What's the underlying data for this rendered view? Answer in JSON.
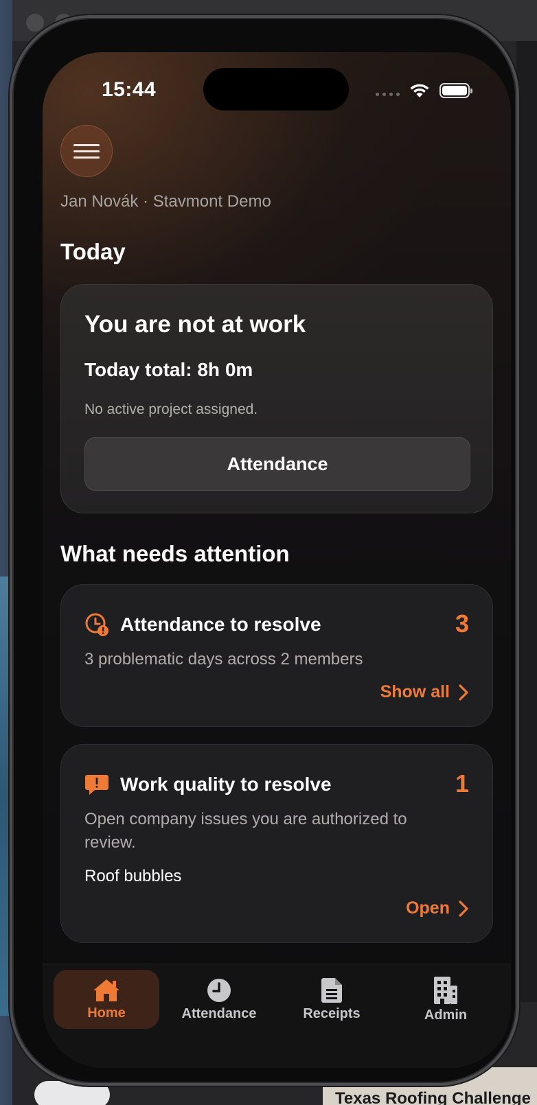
{
  "backdrop": {
    "bottom_text": "Texas Roofing Challenge"
  },
  "status_bar": {
    "time": "15:44"
  },
  "header": {
    "user_line": "Jan Novák · Stavmont Demo"
  },
  "today": {
    "section_title": "Today",
    "status": "You are not at work",
    "total": "Today total: 8h 0m",
    "note": "No active project assigned.",
    "attendance_button": "Attendance"
  },
  "attention": {
    "section_title": "What needs attention",
    "cards": [
      {
        "title": "Attendance to resolve",
        "count": "3",
        "description": "3 problematic days across 2 members",
        "action": "Show all",
        "icon": "clock-alert-icon"
      },
      {
        "title": "Work quality to resolve",
        "count": "1",
        "description": "Open company issues you are authorized to review.",
        "item": "Roof bubbles",
        "action": "Open",
        "icon": "message-alert-icon"
      }
    ]
  },
  "tabbar": {
    "tabs": [
      {
        "label": "Home",
        "icon": "home-icon",
        "active": true
      },
      {
        "label": "Attendance",
        "icon": "clock-icon",
        "active": false
      },
      {
        "label": "Receipts",
        "icon": "document-icon",
        "active": false
      },
      {
        "label": "Admin",
        "icon": "building-icon",
        "active": false
      }
    ]
  },
  "colors": {
    "accent": "#ef7a36",
    "card_bg": "#1f1f21",
    "text_primary": "#ffffff",
    "text_secondary": "#b0adab"
  }
}
